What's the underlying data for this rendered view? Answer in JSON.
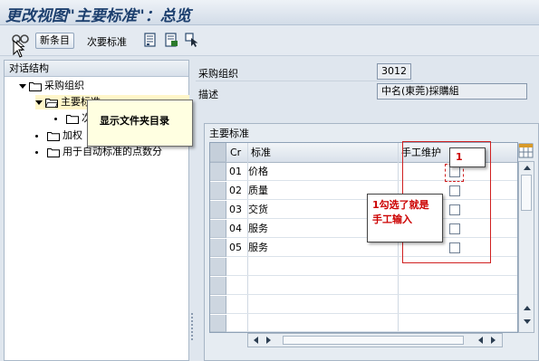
{
  "window": {
    "title": "更改视图\"主要标准\"：总览"
  },
  "toolbar": {
    "new_entries_label": "新条目",
    "secondary_criteria_label": "次要标准",
    "icons": [
      "glasses-edit-icon",
      "copy-icon",
      "delete-icon",
      "select-all-icon"
    ]
  },
  "left_panel": {
    "header": "对话结构",
    "tree": [
      {
        "label": "采购组织",
        "level": 1,
        "expanded": true
      },
      {
        "label": "主要标准",
        "level": 2,
        "expanded": true,
        "selected": true
      },
      {
        "label": "次要标准",
        "level": 3,
        "visible_text": "次"
      },
      {
        "label": "加权",
        "level": 1
      },
      {
        "label": "用于自动标准的点数分",
        "level": 1
      }
    ]
  },
  "tooltip": {
    "text": "显示文件夹目录"
  },
  "form": {
    "purch_org_label": "采购组织",
    "purch_org_value": "3012",
    "desc_label": "描述",
    "desc_value": "中名(東莞)採購組"
  },
  "group": {
    "title": "主要标准",
    "columns": [
      "Cr",
      "标准",
      "手工维护"
    ],
    "rows": [
      {
        "cr": "01",
        "name": "价格",
        "manual": false
      },
      {
        "cr": "02",
        "name": "质量",
        "manual": false
      },
      {
        "cr": "03",
        "name": "交货",
        "manual": false
      },
      {
        "cr": "04",
        "name": "服务",
        "manual": false
      },
      {
        "cr": "05",
        "name": "服务",
        "manual": false
      }
    ]
  },
  "annotations": {
    "callout_number": "1",
    "callout_text_line1": "1勾选了就是",
    "callout_text_line2": "手工输入",
    "color": "#cc0000"
  }
}
